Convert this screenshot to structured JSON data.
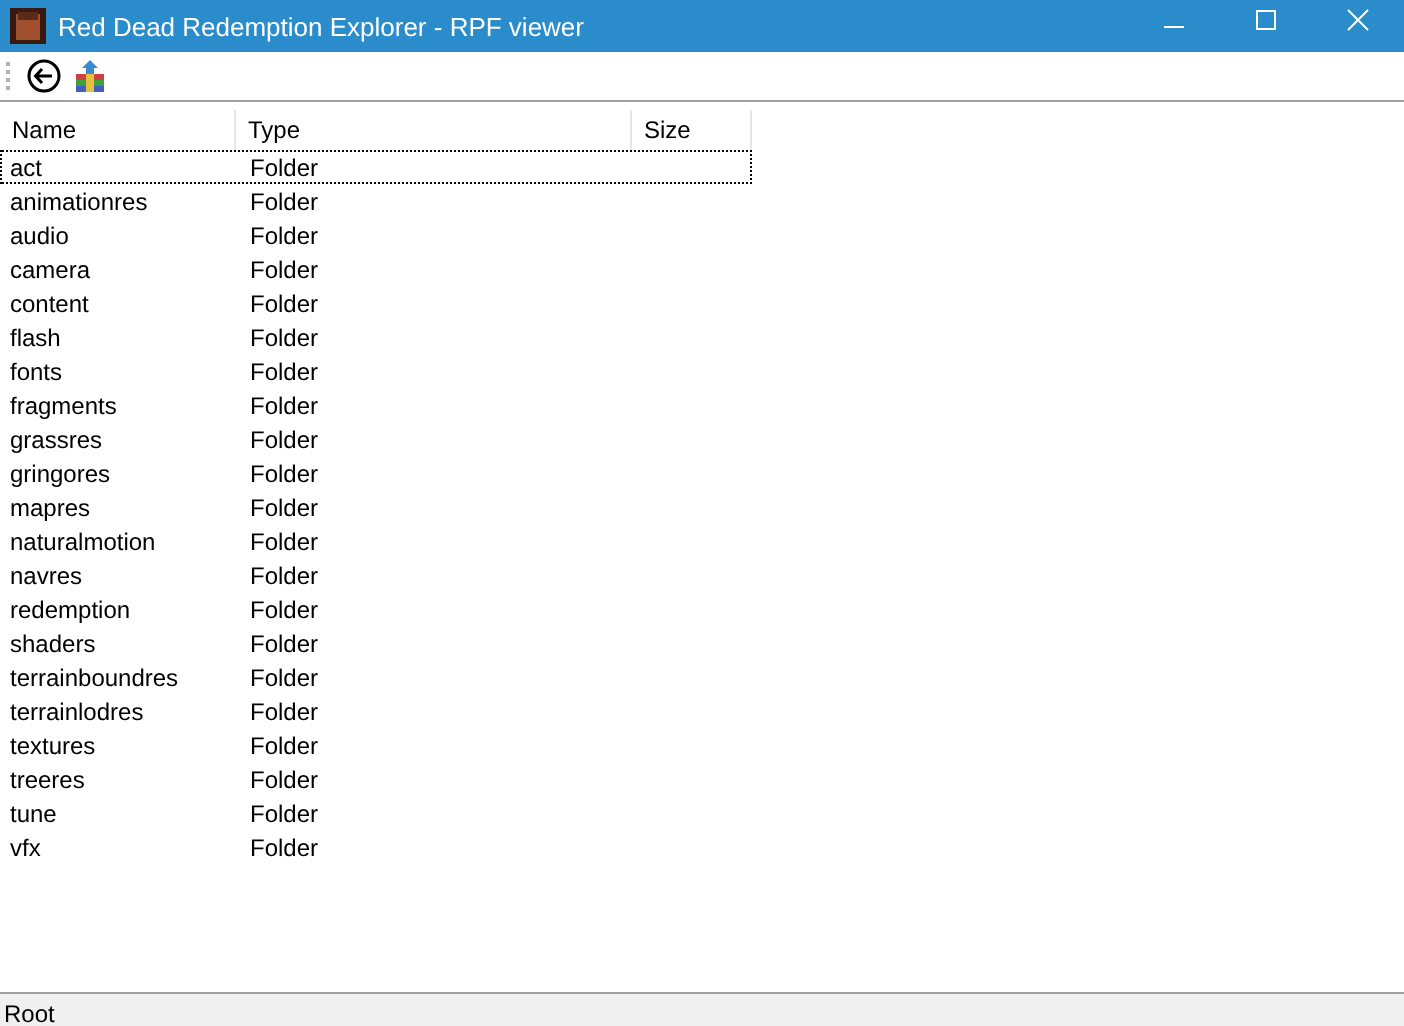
{
  "window": {
    "title": "Red Dead Redemption Explorer - RPF viewer"
  },
  "toolbar": [
    {
      "kind": "back"
    },
    {
      "kind": "archive"
    }
  ],
  "table": {
    "columns": [
      "Name",
      "Type",
      "Size"
    ],
    "rows": [
      {
        "name": "act",
        "type": "Folder",
        "focused": true
      },
      {
        "name": "animationres",
        "type": "Folder",
        "focused": false
      },
      {
        "name": "audio",
        "type": "Folder",
        "focused": false
      },
      {
        "name": "camera",
        "type": "Folder",
        "focused": false
      },
      {
        "name": "content",
        "type": "Folder",
        "focused": false
      },
      {
        "name": "flash",
        "type": "Folder",
        "focused": false
      },
      {
        "name": "fonts",
        "type": "Folder",
        "focused": false
      },
      {
        "name": "fragments",
        "type": "Folder",
        "focused": false
      },
      {
        "name": "grassres",
        "type": "Folder",
        "focused": false
      },
      {
        "name": "gringores",
        "type": "Folder",
        "focused": false
      },
      {
        "name": "mapres",
        "type": "Folder",
        "focused": false
      },
      {
        "name": "naturalmotion",
        "type": "Folder",
        "focused": false
      },
      {
        "name": "navres",
        "type": "Folder",
        "focused": false
      },
      {
        "name": "redemption",
        "type": "Folder",
        "focused": false
      },
      {
        "name": "shaders",
        "type": "Folder",
        "focused": false
      },
      {
        "name": "terrainboundres",
        "type": "Folder",
        "focused": false
      },
      {
        "name": "terrainlodres",
        "type": "Folder",
        "focused": false
      },
      {
        "name": "textures",
        "type": "Folder",
        "focused": false
      },
      {
        "name": "treeres",
        "type": "Folder",
        "focused": false
      },
      {
        "name": "tune",
        "type": "Folder",
        "focused": false
      },
      {
        "name": "vfx",
        "type": "Folder",
        "focused": false
      }
    ]
  },
  "status_bar": {
    "text": "Root"
  }
}
